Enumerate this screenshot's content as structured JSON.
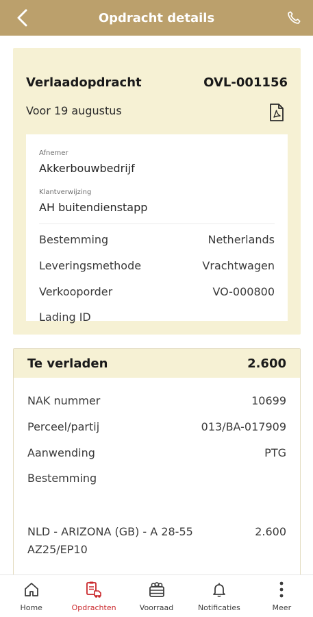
{
  "header": {
    "title": "Opdracht details",
    "back_icon": "arrow-left-icon",
    "phone_icon": "phone-icon",
    "bg_color": "#bba06c"
  },
  "order": {
    "type_label": "Verlaadopdracht",
    "number": "OVL-001156",
    "due": "Voor 19 augustus",
    "pdf_icon": "pdf-file-icon",
    "customer_label": "Afnemer",
    "customer": "Akkerbouwbedrijf",
    "reference_label": "Klantverwijzing",
    "reference": "AH buitendienstapp",
    "details": [
      {
        "label": "Bestemming",
        "value": "Netherlands"
      },
      {
        "label": "Leveringsmethode",
        "value": "Vrachtwagen"
      },
      {
        "label": "Verkooporder",
        "value": "VO-000800"
      },
      {
        "label": "Lading ID",
        "value": ""
      }
    ]
  },
  "load": {
    "title": "Te verladen",
    "total": "2.600",
    "details": [
      {
        "label": "NAK nummer",
        "value": "10699"
      },
      {
        "label": "Perceel/partij",
        "value": "013/BA-017909"
      },
      {
        "label": "Aanwending",
        "value": "PTG"
      },
      {
        "label": "Bestemming",
        "value": ""
      }
    ],
    "line_item": {
      "desc_line1": "NLD - ARIZONA (GB) - A 28-55",
      "desc_line2": "AZ25/EP10",
      "qty": "2.600"
    }
  },
  "nav": {
    "items": [
      {
        "label": "Home",
        "icon": "home-icon"
      },
      {
        "label": "Opdrachten",
        "icon": "truck-clipboard-icon"
      },
      {
        "label": "Voorraad",
        "icon": "storage-crate-icon"
      },
      {
        "label": "Notificaties",
        "icon": "bell-icon"
      },
      {
        "label": "Meer",
        "icon": "more-vertical-icon"
      }
    ],
    "active_color": "#c9262a"
  }
}
